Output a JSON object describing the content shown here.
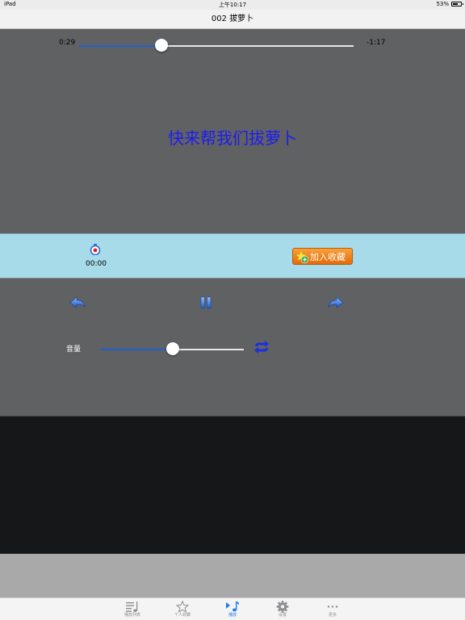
{
  "status": {
    "device": "iPad",
    "time": "上午10:17",
    "battery": "53%"
  },
  "nav": {
    "title": "002 拔萝卜"
  },
  "player": {
    "elapsed": "0:29",
    "remaining": "-1:17",
    "progress": 0.3,
    "lyric": "快来帮我们拔萝卜"
  },
  "actions": {
    "timer": "00:00",
    "favorite_label": "加入收藏"
  },
  "controls": {
    "volume_label": "音量",
    "volume": 0.5
  },
  "tabs": [
    {
      "label": "播放列表",
      "icon": "playlist-icon"
    },
    {
      "label": "个人收藏",
      "icon": "star-icon"
    },
    {
      "label": "播放",
      "icon": "music-note-icon",
      "active": true
    },
    {
      "label": "设置",
      "icon": "gear-icon"
    },
    {
      "label": "更多",
      "icon": "more-icon"
    }
  ],
  "colors": {
    "accent": "#1a7cf5",
    "lyric": "#1c1cf0",
    "action_bar": "#a8dbe9",
    "favorite_button": "#f08a22"
  }
}
